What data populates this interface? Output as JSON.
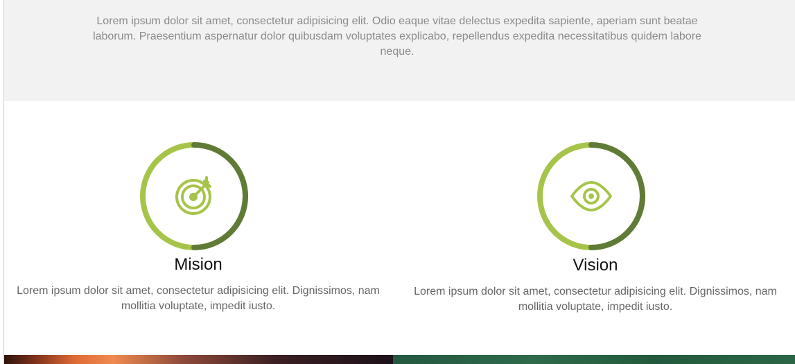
{
  "intro": {
    "text": "Lorem ipsum dolor sit amet, consectetur adipisicing elit. Odio eaque vitae delectus expedita sapiente, aperiam sunt beatae laborum. Praesentium aspernatur dolor quibusdam voluptates explicabo, repellendus expedita necessitatibus quidem labore neque."
  },
  "cards": [
    {
      "title": "Mision",
      "text": "Lorem ipsum dolor sit amet, consectetur adipisicing elit. Dignissimos, nam mollitia voluptate, impedit iusto.",
      "icon": "target-icon"
    },
    {
      "title": "Vision",
      "text": "Lorem ipsum dolor sit amet, consectetur adipisicing elit. Dignissimos, nam mollitia voluptate, impedit iusto.",
      "icon": "eye-icon"
    }
  ],
  "colors": {
    "intro_background": "#f2f2f2",
    "intro_text": "#8a8a8a",
    "ring_light": "#a7c44a",
    "ring_dark": "#5f7b37",
    "title": "#111111",
    "body_text": "#666666"
  }
}
